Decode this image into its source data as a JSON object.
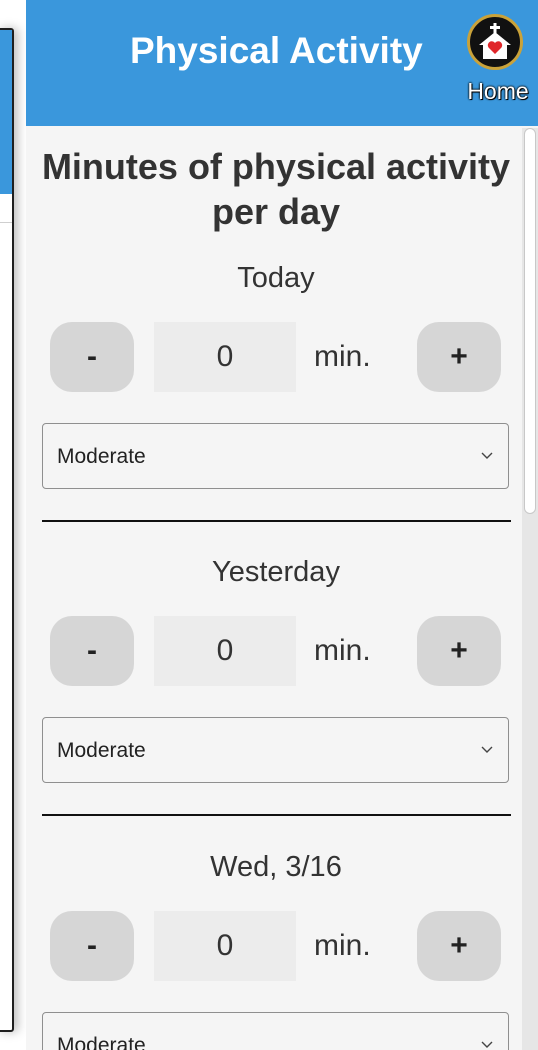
{
  "header": {
    "title": "Physical Activity",
    "home_label": "Home"
  },
  "main": {
    "title": "Minutes of physical activity per day",
    "days": [
      {
        "label": "Today",
        "minutes": "0",
        "unit": "min.",
        "minus": "-",
        "plus": "+",
        "intensity": "Moderate"
      },
      {
        "label": "Yesterday",
        "minutes": "0",
        "unit": "min.",
        "minus": "-",
        "plus": "+",
        "intensity": "Moderate"
      },
      {
        "label": "Wed, 3/16",
        "minutes": "0",
        "unit": "min.",
        "minus": "-",
        "plus": "+",
        "intensity": "Moderate"
      }
    ]
  },
  "colors": {
    "header": "#3a97dc",
    "background": "#f5f5f5",
    "button": "#d6d6d6"
  },
  "icons": {
    "home": "church-heart-icon",
    "dropdown": "chevron-down-icon"
  }
}
